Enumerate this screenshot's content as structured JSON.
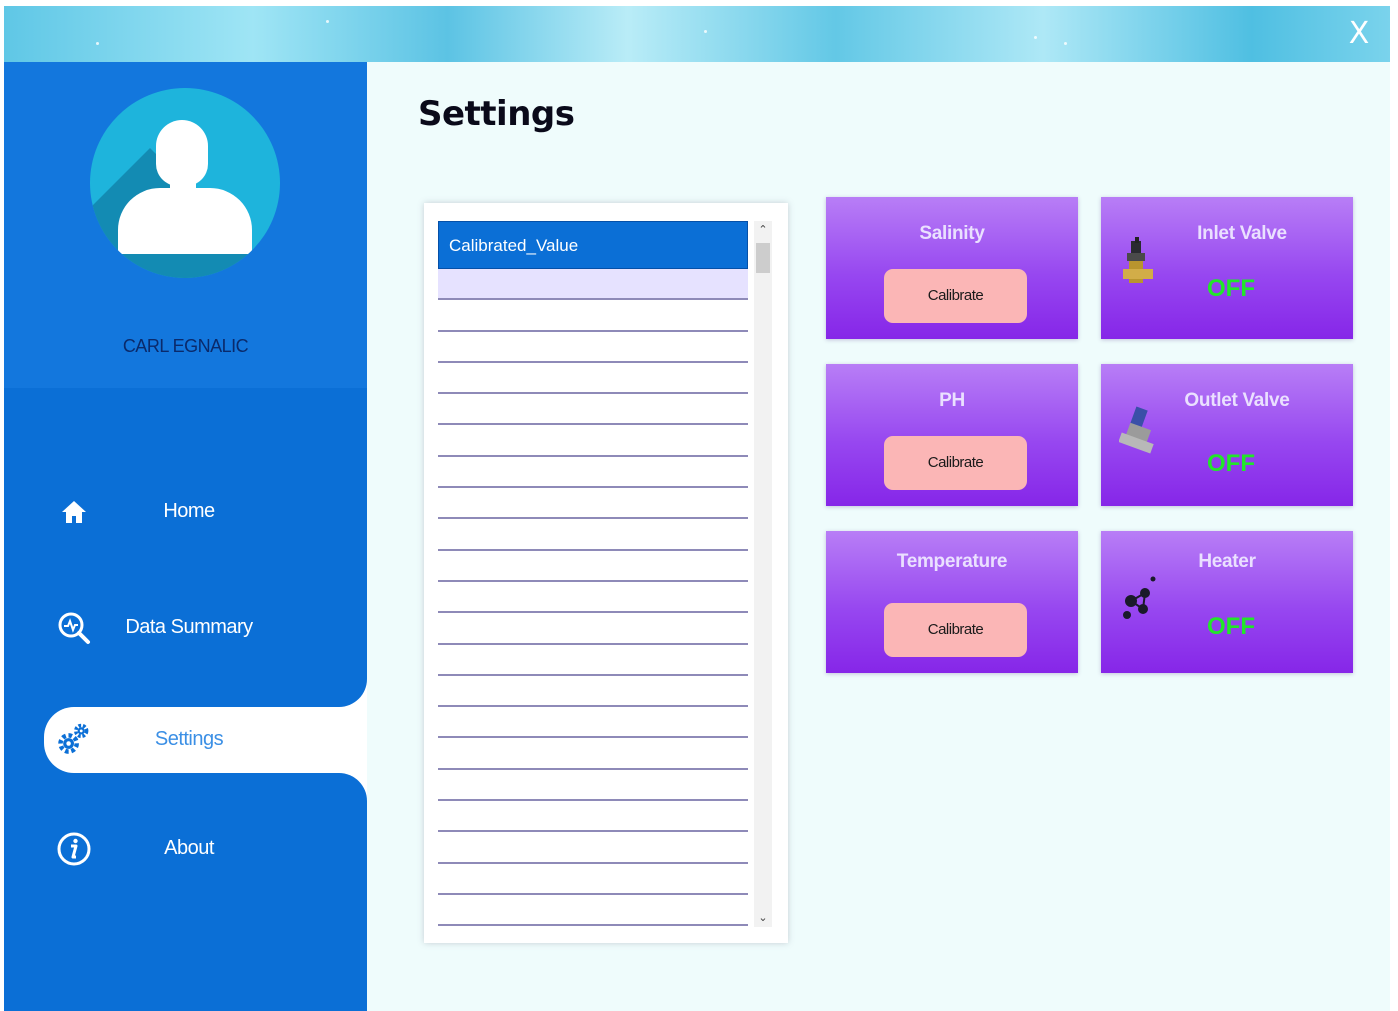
{
  "window": {
    "close_label": "X"
  },
  "sidebar": {
    "username": "CARL EGNALIC",
    "items": [
      {
        "label": "Home",
        "icon": "home-icon"
      },
      {
        "label": "Data Summary",
        "icon": "data-summary-icon"
      },
      {
        "label": "Settings",
        "icon": "settings-gear-icon",
        "active": true
      },
      {
        "label": "About",
        "icon": "info-icon"
      }
    ]
  },
  "main": {
    "title": "Settings",
    "list": {
      "header": "Calibrated_Value",
      "rows": [
        "",
        "",
        "",
        "",
        "",
        "",
        "",
        "",
        "",
        "",
        "",
        "",
        "",
        "",
        "",
        "",
        "",
        "",
        "",
        "",
        ""
      ]
    },
    "sensors": [
      {
        "title": "Salinity",
        "button": "Calibrate"
      },
      {
        "title": "PH",
        "button": "Calibrate"
      },
      {
        "title": "Temperature",
        "button": "Calibrate"
      }
    ],
    "devices": [
      {
        "title": "Inlet Valve",
        "status": "OFF",
        "icon": "valve-icon"
      },
      {
        "title": "Outlet Valve",
        "status": "OFF",
        "icon": "valve-icon"
      },
      {
        "title": "Heater",
        "status": "OFF",
        "icon": "heater-icon"
      }
    ]
  },
  "colors": {
    "sidebar": "#0b6fd6",
    "card_gradient_top": "#b87ef6",
    "card_gradient_bottom": "#8626e8",
    "status_off": "#22e62b",
    "calibrate_button": "#fbb6b6"
  }
}
